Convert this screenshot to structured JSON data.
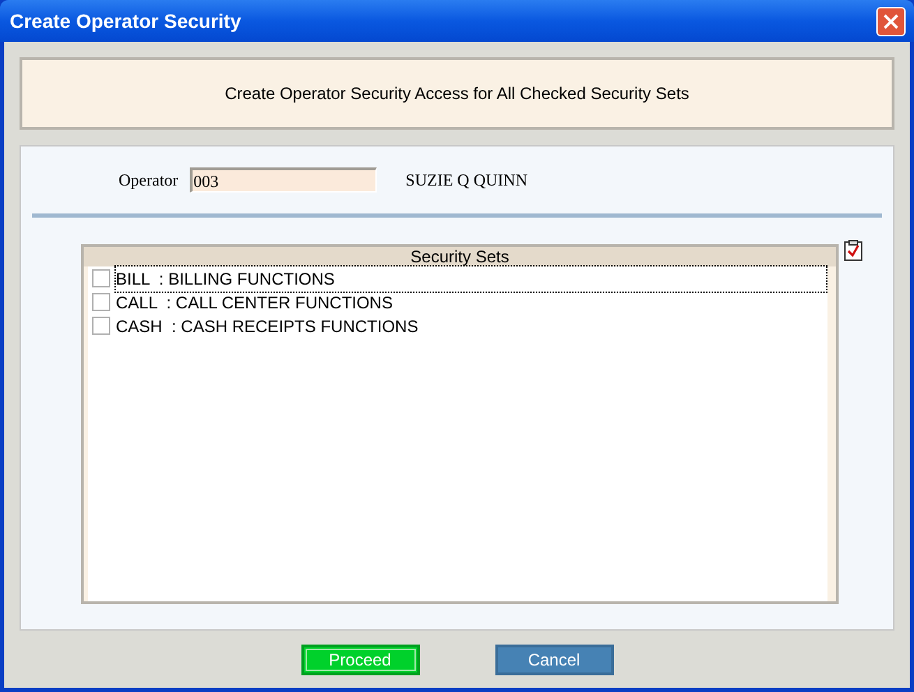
{
  "window": {
    "title": "Create Operator Security"
  },
  "banner": "Create Operator Security Access for All Checked Security Sets",
  "operator": {
    "label": "Operator",
    "value": "003",
    "name": "SUZIE Q QUINN"
  },
  "security_sets": {
    "heading": "Security Sets",
    "items": [
      {
        "code": "BILL",
        "description": ": BILLING FUNCTIONS",
        "checked": false,
        "focused": true
      },
      {
        "code": "CALL",
        "description": ": CALL CENTER FUNCTIONS",
        "checked": false,
        "focused": false
      },
      {
        "code": "CASH",
        "description": ": CASH RECEIPTS FUNCTIONS",
        "checked": false,
        "focused": false
      }
    ]
  },
  "buttons": [
    {
      "label": "Proceed",
      "kind": "primary"
    },
    {
      "label": "Cancel",
      "kind": "secondary"
    }
  ]
}
